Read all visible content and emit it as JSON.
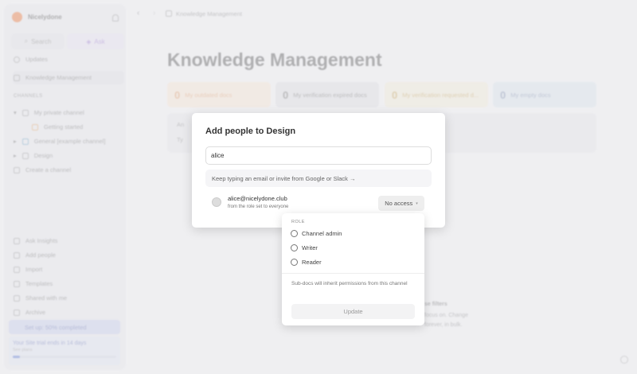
{
  "sidebar": {
    "brand": "Nicelydone",
    "search": "Search",
    "ask": "Ask",
    "updates": "Updates",
    "km": "Knowledge Management",
    "channels_heading": "CHANNELS",
    "channels": [
      "My private channel",
      "Getting started",
      "General [example channel]",
      "Design",
      "Create a channel"
    ],
    "bottom": [
      "Ask Insights",
      "Add people",
      "Import",
      "Templates",
      "Shared with me",
      "Archive"
    ],
    "setup": "Set up: 50% completed",
    "trial": "Your Site trial ends in 14 days",
    "see_plans": "See plans",
    "trial_progress": 0.07
  },
  "breadcrumb": "Knowledge Management",
  "main": {
    "title": "Knowledge Management",
    "cards": [
      {
        "count": "0",
        "label": "My outdated docs"
      },
      {
        "count": "0",
        "label": "My verification expired docs"
      },
      {
        "count": "0",
        "label": "My verification requested d..."
      },
      {
        "count": "0",
        "label": "My empty docs"
      }
    ],
    "frag1": "An",
    "frag2": "Ty",
    "frag3": "se filters",
    "frag4": "focus on. Change",
    "frag5": "forever, in bulk."
  },
  "modal": {
    "title": "Add people to Design",
    "input_value": "alice",
    "hint": "Keep typing an email or invite from Google or Slack →",
    "email": "alice@nicelydone.club",
    "sub": "from the role set to everyone",
    "access": "No access",
    "caret": "▾"
  },
  "dropdown": {
    "heading": "ROLE",
    "options": [
      "Channel admin",
      "Writer",
      "Reader"
    ],
    "note": "Sub-docs will inherit permissions from this channel",
    "update": "Update"
  }
}
